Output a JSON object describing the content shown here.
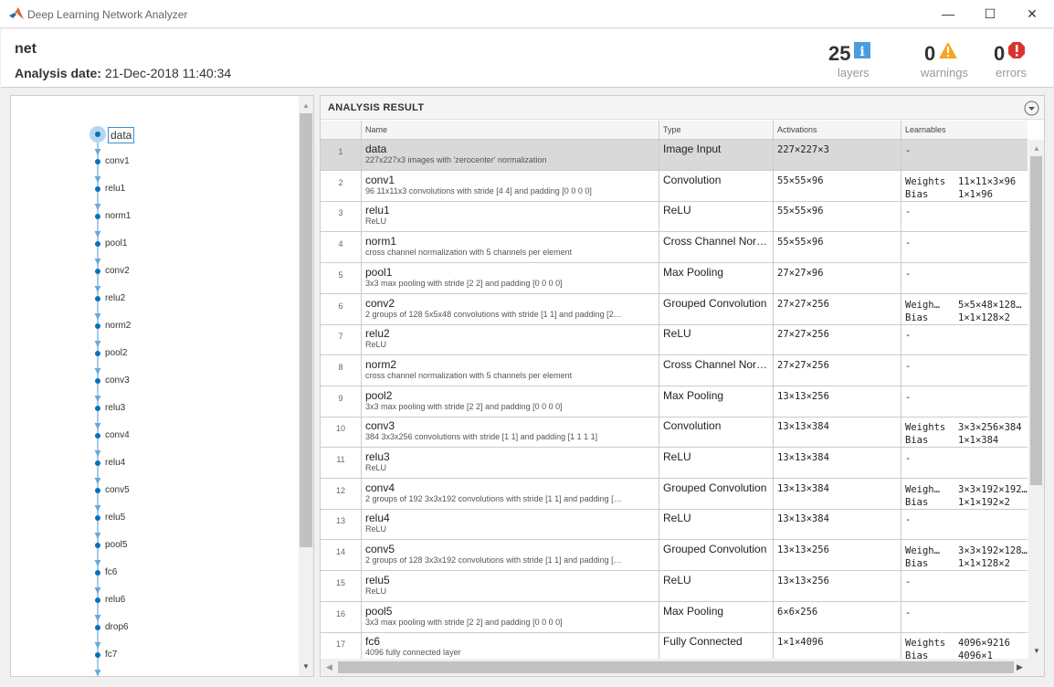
{
  "window": {
    "title": "Deep Learning Network Analyzer",
    "minimize": "—",
    "maximize": "☐",
    "close": "✕"
  },
  "header": {
    "net_name": "net",
    "date_label": "Analysis date:",
    "date_value": "21-Dec-2018 11:40:34"
  },
  "stats": {
    "layers": {
      "count": "25",
      "label": "layers"
    },
    "warnings": {
      "count": "0",
      "label": "warnings"
    },
    "errors": {
      "count": "0",
      "label": "errors"
    }
  },
  "colors": {
    "info": "#4a9de0",
    "warning": "#f5a623",
    "error": "#d9342b",
    "accent": "#0072bd"
  },
  "graph": {
    "nodes": [
      "data",
      "conv1",
      "relu1",
      "norm1",
      "pool1",
      "conv2",
      "relu2",
      "norm2",
      "pool2",
      "conv3",
      "relu3",
      "conv4",
      "relu4",
      "conv5",
      "relu5",
      "pool5",
      "fc6",
      "relu6",
      "drop6",
      "fc7"
    ],
    "selected": "data"
  },
  "result": {
    "title": "ANALYSIS RESULT",
    "columns": [
      "Name",
      "Type",
      "Activations",
      "Learnables"
    ],
    "rows": [
      {
        "i": "1",
        "name": "data",
        "desc": "227x227x3 images with 'zerocenter' normalization",
        "type": "Image Input",
        "act": "227×227×3",
        "learn": [
          [
            "-",
            ""
          ]
        ]
      },
      {
        "i": "2",
        "name": "conv1",
        "desc": "96 11x11x3 convolutions with stride [4 4] and padding [0 0 0 0]",
        "type": "Convolution",
        "act": "55×55×96",
        "learn": [
          [
            "Weights",
            "11×11×3×96"
          ],
          [
            "Bias",
            "1×1×96"
          ]
        ]
      },
      {
        "i": "3",
        "name": "relu1",
        "desc": "ReLU",
        "type": "ReLU",
        "act": "55×55×96",
        "learn": [
          [
            "-",
            ""
          ]
        ]
      },
      {
        "i": "4",
        "name": "norm1",
        "desc": "cross channel normalization with 5 channels per element",
        "type": "Cross Channel Nor…",
        "act": "55×55×96",
        "learn": [
          [
            "-",
            ""
          ]
        ]
      },
      {
        "i": "5",
        "name": "pool1",
        "desc": "3x3 max pooling with stride [2 2] and padding [0 0 0 0]",
        "type": "Max Pooling",
        "act": "27×27×96",
        "learn": [
          [
            "-",
            ""
          ]
        ]
      },
      {
        "i": "6",
        "name": "conv2",
        "desc": "2 groups of 128 5x5x48 convolutions with stride [1 1] and padding [2…",
        "type": "Grouped Convolution",
        "act": "27×27×256",
        "learn": [
          [
            "Weigh…",
            "5×5×48×128…"
          ],
          [
            "Bias",
            "1×1×128×2"
          ]
        ]
      },
      {
        "i": "7",
        "name": "relu2",
        "desc": "ReLU",
        "type": "ReLU",
        "act": "27×27×256",
        "learn": [
          [
            "-",
            ""
          ]
        ]
      },
      {
        "i": "8",
        "name": "norm2",
        "desc": "cross channel normalization with 5 channels per element",
        "type": "Cross Channel Nor…",
        "act": "27×27×256",
        "learn": [
          [
            "-",
            ""
          ]
        ]
      },
      {
        "i": "9",
        "name": "pool2",
        "desc": "3x3 max pooling with stride [2 2] and padding [0 0 0 0]",
        "type": "Max Pooling",
        "act": "13×13×256",
        "learn": [
          [
            "-",
            ""
          ]
        ]
      },
      {
        "i": "10",
        "name": "conv3",
        "desc": "384 3x3x256 convolutions with stride [1 1] and padding [1 1 1 1]",
        "type": "Convolution",
        "act": "13×13×384",
        "learn": [
          [
            "Weights",
            "3×3×256×384"
          ],
          [
            "Bias",
            "1×1×384"
          ]
        ]
      },
      {
        "i": "11",
        "name": "relu3",
        "desc": "ReLU",
        "type": "ReLU",
        "act": "13×13×384",
        "learn": [
          [
            "-",
            ""
          ]
        ]
      },
      {
        "i": "12",
        "name": "conv4",
        "desc": "2 groups of 192 3x3x192 convolutions with stride [1 1] and padding […",
        "type": "Grouped Convolution",
        "act": "13×13×384",
        "learn": [
          [
            "Weigh…",
            "3×3×192×192…"
          ],
          [
            "Bias",
            "1×1×192×2"
          ]
        ]
      },
      {
        "i": "13",
        "name": "relu4",
        "desc": "ReLU",
        "type": "ReLU",
        "act": "13×13×384",
        "learn": [
          [
            "-",
            ""
          ]
        ]
      },
      {
        "i": "14",
        "name": "conv5",
        "desc": "2 groups of 128 3x3x192 convolutions with stride [1 1] and padding […",
        "type": "Grouped Convolution",
        "act": "13×13×256",
        "learn": [
          [
            "Weigh…",
            "3×3×192×128…"
          ],
          [
            "Bias",
            "1×1×128×2"
          ]
        ]
      },
      {
        "i": "15",
        "name": "relu5",
        "desc": "ReLU",
        "type": "ReLU",
        "act": "13×13×256",
        "learn": [
          [
            "-",
            ""
          ]
        ]
      },
      {
        "i": "16",
        "name": "pool5",
        "desc": "3x3 max pooling with stride [2 2] and padding [0 0 0 0]",
        "type": "Max Pooling",
        "act": "6×6×256",
        "learn": [
          [
            "-",
            ""
          ]
        ]
      },
      {
        "i": "17",
        "name": "fc6",
        "desc": "4096 fully connected layer",
        "type": "Fully Connected",
        "act": "1×1×4096",
        "learn": [
          [
            "Weights",
            "4096×9216"
          ],
          [
            "Bias",
            "4096×1"
          ]
        ]
      }
    ]
  }
}
